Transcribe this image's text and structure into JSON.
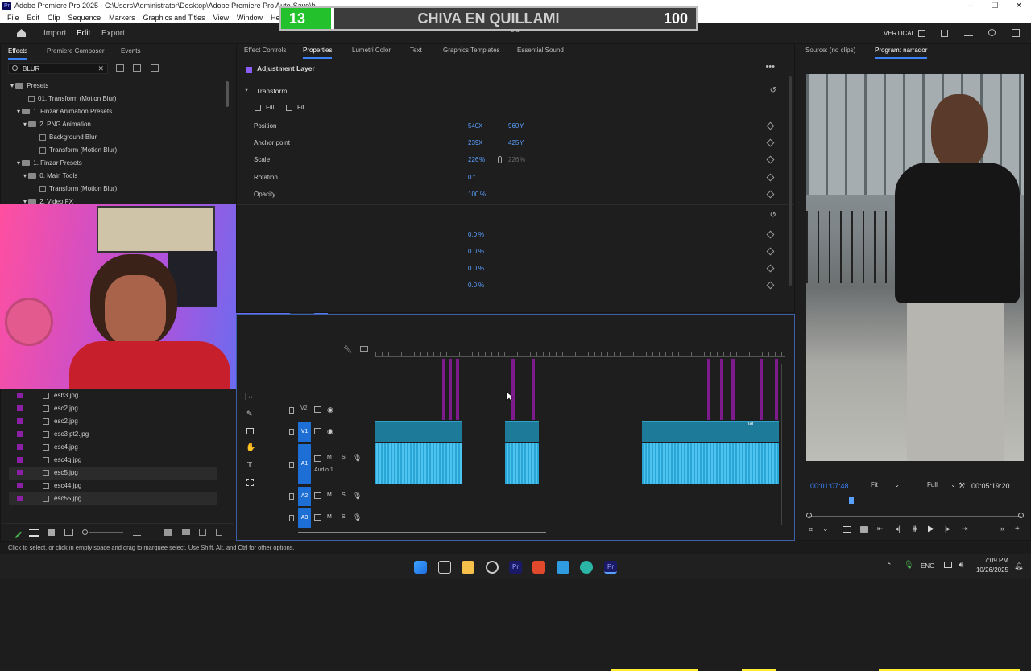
{
  "window": {
    "title": "Adobe Premiere Pro 2025 - C:\\Users\\Administrator\\Desktop\\Adobe Premiere Pro Auto-Save\\b",
    "controls": [
      "–",
      "☐",
      "✕"
    ]
  },
  "menu": [
    "File",
    "Edit",
    "Clip",
    "Sequence",
    "Markers",
    "Graphics and Titles",
    "View",
    "Window",
    "Help"
  ],
  "overlay": {
    "left_number": "13",
    "title": "CHIVA EN QUILLAMI",
    "right_number": "100"
  },
  "header": {
    "nav": [
      "Import",
      "Edit",
      "Export"
    ],
    "project": "blu",
    "workspace": "VERTICAL"
  },
  "effects_panel": {
    "tabs": [
      "Effects",
      "Premiere Composer",
      "Events"
    ],
    "search_value": "BLUR",
    "tree": [
      {
        "label": "Presets",
        "level": 0,
        "type": "folder"
      },
      {
        "label": "01. Transform (Motion Blur)",
        "level": 1,
        "type": "preset"
      },
      {
        "label": "1. Finzar Animation Presets",
        "level": 1,
        "type": "folder"
      },
      {
        "label": "2. PNG Animation",
        "level": 2,
        "type": "folder"
      },
      {
        "label": "Background Blur",
        "level": 3,
        "type": "preset"
      },
      {
        "label": "Transform (Motion Blur)",
        "level": 3,
        "type": "preset"
      },
      {
        "label": "1. Finzar Presets",
        "level": 1,
        "type": "folder"
      },
      {
        "label": "0. Main Tools",
        "level": 2,
        "type": "folder"
      },
      {
        "label": "Transform (Motion Blur)",
        "level": 3,
        "type": "preset"
      },
      {
        "label": "2. Video FX",
        "level": 2,
        "type": "folder"
      }
    ]
  },
  "project_files": [
    "esb3.jpg",
    "esc2.jpg",
    "esc2.jpg",
    "esc3 pt2.jpg",
    "esc4.jpg",
    "esc4q.jpg",
    "esc5.jpg",
    "esc44.jpg",
    "esc55.jpg"
  ],
  "properties_panel": {
    "tabs": [
      "Effect Controls",
      "Properties",
      "Lumetri Color",
      "Text",
      "Graphics Templates",
      "Essential Sound"
    ],
    "layer_name": "Adjustment Layer",
    "section": "Transform",
    "fill_label": "Fill",
    "fit_label": "Fit",
    "rows": [
      {
        "label": "Position",
        "v1": "540",
        "u1": "X",
        "v2": "960",
        "u2": "Y"
      },
      {
        "label": "Anchor point",
        "v1": "239",
        "u1": "X",
        "v2": "425",
        "u2": "Y"
      },
      {
        "label": "Scale",
        "v1": "226",
        "u1": "%",
        "v2": "226",
        "u2": "%"
      },
      {
        "label": "Rotation",
        "v1": "0",
        "u1": "°",
        "v2": "",
        "u2": ""
      },
      {
        "label": "Opacity",
        "v1": "100",
        "u1": "%",
        "v2": "",
        "u2": ""
      }
    ],
    "extra_values": [
      "0.0",
      "0.0",
      "0.0",
      "0.0"
    ],
    "extra_unit": "%"
  },
  "monitor": {
    "source_tab": "Source: (no clips)",
    "program_tab": "Program: narrador",
    "current_time": "00:01:07:48",
    "fit": "Fit",
    "quality": "Full",
    "duration": "00:05:19:20"
  },
  "timeline": {
    "tracks": [
      {
        "name": "V2"
      },
      {
        "name": "V1"
      },
      {
        "name": "A1",
        "label": "Audio 1"
      },
      {
        "name": "A2"
      },
      {
        "name": "A3"
      }
    ],
    "clip_label": "nar"
  },
  "status_text": "Click to select, or click in empty space and drag to marquee select. Use Shift, Alt, and Ctrl for other options.",
  "taskbar": {
    "lang": "ENG",
    "time": "7:09 PM",
    "date": "10/26/2025"
  },
  "colors": {
    "accent": "#3b82f6",
    "clip_video": "#1e7a99",
    "clip_audio": "#2aa6d6",
    "adjustment": "#7d1b8c",
    "score_green": "#23c12b"
  }
}
